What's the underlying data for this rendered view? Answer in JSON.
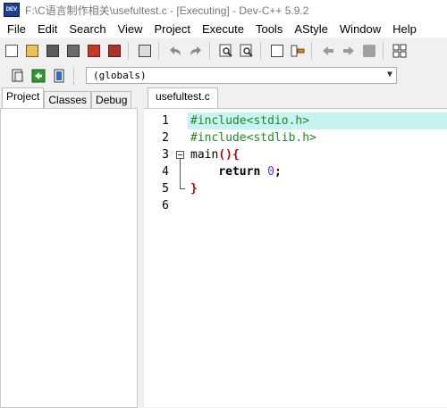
{
  "window": {
    "app_icon_text": "DEV",
    "title": "F:\\C语言制作相关\\usefultest.c - [Executing] - Dev-C++ 5.9.2"
  },
  "menu": [
    "File",
    "Edit",
    "Search",
    "View",
    "Project",
    "Execute",
    "Tools",
    "AStyle",
    "Window",
    "Help"
  ],
  "scope_combo": {
    "value": "(globals)"
  },
  "left_tabs": [
    "Project",
    "Classes",
    "Debug"
  ],
  "editor_tab": "usefultest.c",
  "line_numbers": [
    "1",
    "2",
    "3",
    "4",
    "5",
    "6"
  ],
  "code": {
    "line1": "#include<stdio.h>",
    "line2": "#include<stdlib.h>",
    "line3_name": "main",
    "line3_paren": "(){",
    "line4_keyword": "return",
    "line4_value": "0",
    "line4_semicolon": ";",
    "line5": "}"
  },
  "colors": {
    "highlight": "#c8f3f3",
    "preprocessor": "#1e8a1e",
    "number": "#7b2bd6",
    "brace": "#c00000"
  }
}
